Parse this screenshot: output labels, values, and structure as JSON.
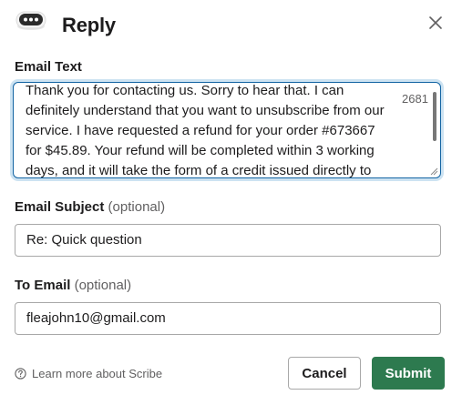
{
  "header": {
    "title": "Reply",
    "app_icon": "chat-bot-icon",
    "close_icon": "close-icon"
  },
  "email_text": {
    "label": "Email Text",
    "lines": [
      "Thank you for contacting us. Sorry to hear that. I can",
      "definitely understand that you want to unsubscribe from our",
      "service. I have requested a refund for your order #673667",
      "for $45.89. Your refund will be completed within 3 working",
      "days, and it will take the form of a credit issued directly to"
    ],
    "counter": "2681"
  },
  "email_subject": {
    "label": "Email Subject",
    "optional": "(optional)",
    "value": "Re: Quick question"
  },
  "to_email": {
    "label": "To Email",
    "optional": "(optional)",
    "value": "fleajohn10@gmail.com"
  },
  "footer": {
    "help_link": "Learn more about Scribe",
    "help_icon": "question-circle-icon",
    "cancel_label": "Cancel",
    "submit_label": "Submit"
  },
  "colors": {
    "submit": "#2d7a4f",
    "focus_border": "#1264a3",
    "focus_ring": "#cde3f2"
  }
}
